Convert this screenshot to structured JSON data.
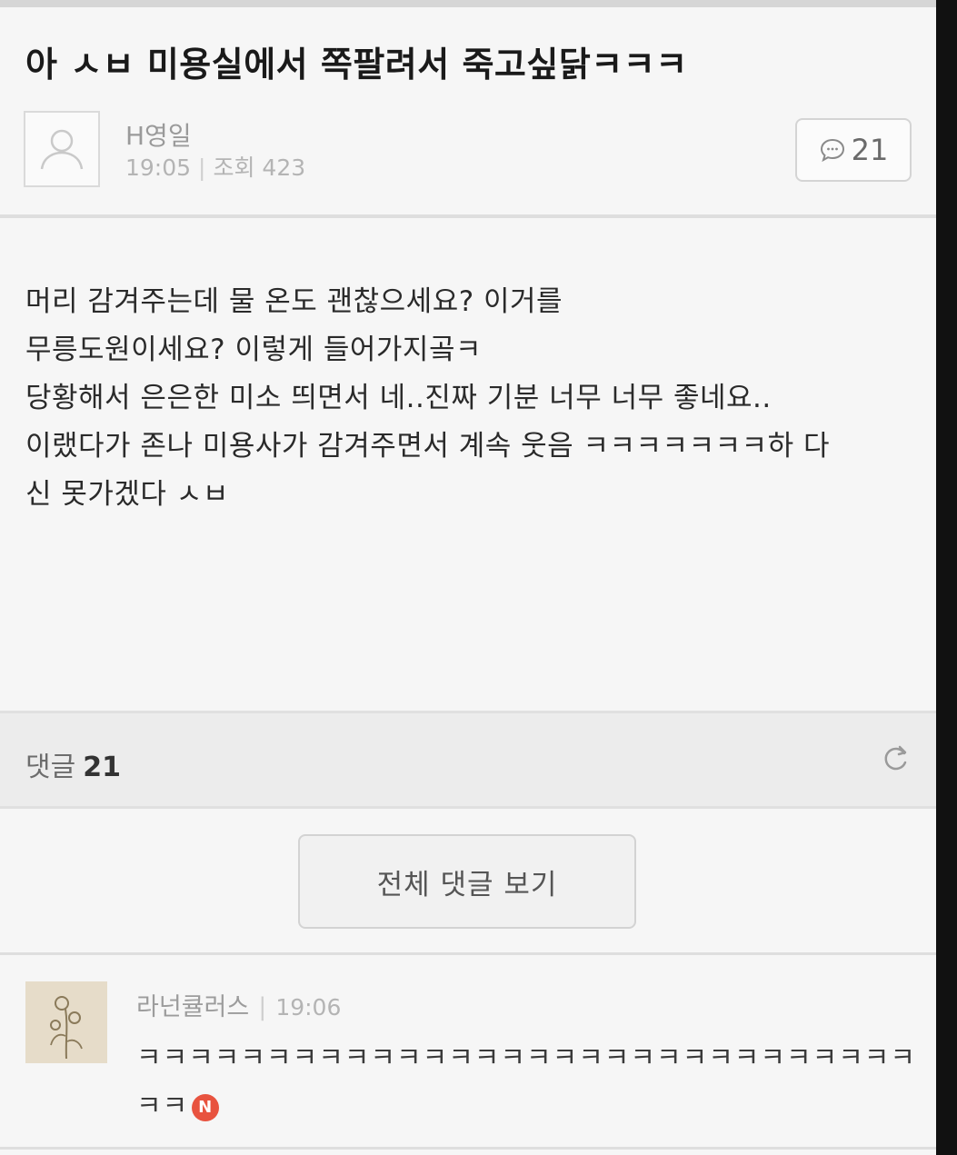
{
  "post": {
    "title": "아 ㅅㅂ 미용실에서 쪽팔려서 죽고싶닭ㅋㅋㅋ",
    "author": "H영일",
    "time": "19:05",
    "views": "조회 423",
    "comment_count": "21",
    "body_lines": [
      "머리 감겨주는데 물 온도 괜찮으세요? 이거를",
      "무릉도원이세요? 이렇게 들어가지곸ㅋ",
      "당황해서 은은한 미소 띄면서 네..진짜 기분 너무 너무 좋네요..",
      "이랬다가 존나 미용사가 감겨주면서 계속 웃음 ㅋㅋㅋㅋㅋㅋㅋ하 다",
      "신 못가겠다 ㅅㅂ"
    ]
  },
  "comments_section": {
    "label": "댓글",
    "count": "21",
    "view_all_label": "전체 댓글 보기"
  },
  "comment": {
    "author": "라넌큘러스",
    "time": "19:06",
    "text": "ㅋㅋㅋㅋㅋㅋㅋㅋㅋㅋㅋㅋㅋㅋㅋㅋㅋㅋㅋㅋㅋㅋㅋㅋㅋㅋㅋㅋㅋㅋㅋㅋ",
    "new_badge": "N"
  },
  "icons": {
    "author_avatar": "default-profile-icon",
    "comment_count": "speech-bubble-icon",
    "refresh": "refresh-icon"
  },
  "colors": {
    "background": "#f6f6f6",
    "header_band": "#ececec",
    "new_badge": "#e8533f"
  }
}
